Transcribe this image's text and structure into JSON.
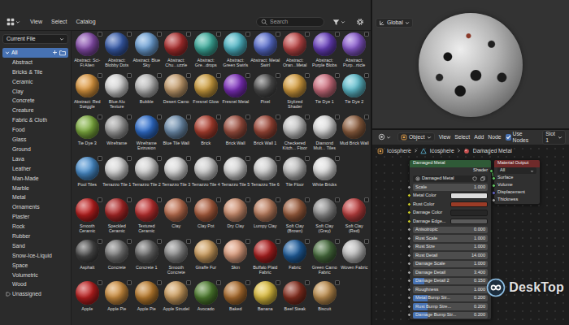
{
  "asset_browser": {
    "menus": [
      "View",
      "Select",
      "Catalog"
    ],
    "search": {
      "placeholder": "Search"
    },
    "library": "Current File",
    "catalog_root": {
      "label": "All",
      "selected": true,
      "expanded": true
    },
    "catalogs": [
      {
        "label": "Abstract",
        "selected": false
      },
      {
        "label": "Bricks & Tile",
        "selected": false
      },
      {
        "label": "Ceramic",
        "selected": false
      },
      {
        "label": "Clay",
        "selected": false
      },
      {
        "label": "Concrete",
        "selected": false
      },
      {
        "label": "Creature",
        "selected": false
      },
      {
        "label": "Fabric & Cloth",
        "selected": false
      },
      {
        "label": "Food",
        "selected": false
      },
      {
        "label": "Glass",
        "selected": false
      },
      {
        "label": "Ground",
        "selected": false
      },
      {
        "label": "Lava",
        "selected": false
      },
      {
        "label": "Leather",
        "selected": false
      },
      {
        "label": "Man-Made",
        "selected": false
      },
      {
        "label": "Marble",
        "selected": false
      },
      {
        "label": "Metal",
        "selected": false
      },
      {
        "label": "Ornaments",
        "selected": false
      },
      {
        "label": "Plaster",
        "selected": false
      },
      {
        "label": "Rock",
        "selected": false
      },
      {
        "label": "Rubber",
        "selected": false
      },
      {
        "label": "Sand",
        "selected": false
      },
      {
        "label": "Snow-Ice-Liquid",
        "selected": false
      },
      {
        "label": "Space",
        "selected": false
      },
      {
        "label": "Volumetric",
        "selected": false
      },
      {
        "label": "Wood",
        "selected": false
      }
    ],
    "unassigned": {
      "label": "Unassigned",
      "selected": false
    },
    "assets": [
      [
        {
          "label": "Abstract: Sci-Fi Alien",
          "color": "#8a4fb0"
        },
        {
          "label": "Abstract: Blobby Dots",
          "color": "#3a5fb0"
        },
        {
          "label": "Abstract: Blue Sky",
          "color": "#6fa3d9"
        },
        {
          "label": "Abstract: Chu...uzzle",
          "color": "#b03030"
        },
        {
          "label": "Abstract: Gre...drops",
          "color": "#3fb0a0"
        },
        {
          "label": "Abstract: Green Swirls",
          "color": "#4fb8c8"
        },
        {
          "label": "Abstract: Metal Swirl",
          "color": "#5a6fd0"
        },
        {
          "label": "Abstract: Oran...Metal",
          "color": "#c04848"
        },
        {
          "label": "Abstract: Purple Blobs",
          "color": "#6a40c0"
        },
        {
          "label": "Abstract: Purp...rticle",
          "color": "#8a5ad0"
        }
      ],
      [
        {
          "label": "Abstract: Red Swiggle",
          "color": "#e09a40"
        },
        {
          "label": "Blue Alu Texture",
          "color": "#d8d8d8"
        },
        {
          "label": "Bubble",
          "color": "#bcbcbc"
        },
        {
          "label": "Desert Camo",
          "color": "#c8a070"
        },
        {
          "label": "Fresnel Glow",
          "color": "#d0a040"
        },
        {
          "label": "Fresnel Metal",
          "color": "#8030c0"
        },
        {
          "label": "Pixel",
          "color": "#505050"
        },
        {
          "label": "Stylized Shader",
          "color": "#d8a040"
        },
        {
          "label": "Tie Dye 1",
          "color": "#d07080"
        },
        {
          "label": "Tie Dye 2",
          "color": "#60c0d0"
        }
      ],
      [
        {
          "label": "Tie Dye 3",
          "color": "#80b040"
        },
        {
          "label": "Wireframe",
          "color": "#a0a0a0"
        },
        {
          "label": "Wireframe Extrusion",
          "color": "#3070d0"
        },
        {
          "label": "Blue Tile Wall",
          "color": "#7090b0"
        },
        {
          "label": "Brick",
          "color": "#b04030"
        },
        {
          "label": "Brick Wall",
          "color": "#a05040"
        },
        {
          "label": "Brick Wall 1",
          "color": "#a04838"
        },
        {
          "label": "Checkered Kitch... Floor",
          "color": "#c8c8c8"
        },
        {
          "label": "Diamond Mult... Tiles",
          "color": "#e0e0e0"
        },
        {
          "label": "Mud Brick Wall",
          "color": "#906040"
        }
      ],
      [
        {
          "label": "Pool Tiles",
          "color": "#4a90d0"
        },
        {
          "label": "Terrazzo Tile 1",
          "color": "#d8d8d8"
        },
        {
          "label": "Terrazzo Tile 2",
          "color": "#d4d4d4"
        },
        {
          "label": "Terrazzo Tile 3",
          "color": "#dadada"
        },
        {
          "label": "Terrazzo Tile 4",
          "color": "#cfcfcf"
        },
        {
          "label": "Terrazzo Tile 5",
          "color": "#d6d6d6"
        },
        {
          "label": "Terrazzo Tile 6",
          "color": "#d2d2d2"
        },
        {
          "label": "Tile Floor",
          "color": "#c0c0c0"
        },
        {
          "label": "White Bricks",
          "color": "#e0e0e0"
        }
      ],
      [
        {
          "label": "Smooth Ceramic",
          "color": "#c02020"
        },
        {
          "label": "Speckled Ceramic",
          "color": "#b02828"
        },
        {
          "label": "Textured Ceramic",
          "color": "#c03030"
        },
        {
          "label": "Clay",
          "color": "#c07050"
        },
        {
          "label": "Clay Pot",
          "color": "#b06040"
        },
        {
          "label": "Dry Clay",
          "color": "#d09070"
        },
        {
          "label": "Lumpy Clay",
          "color": "#c08060"
        },
        {
          "label": "Soft Clay (Brown)",
          "color": "#a06040"
        },
        {
          "label": "Soft Clay (Grey)",
          "color": "#909090"
        },
        {
          "label": "Soft Clay (Red)",
          "color": "#c04040"
        }
      ],
      [
        {
          "label": "Asphalt",
          "color": "#4a4a4a"
        },
        {
          "label": "Concrete",
          "color": "#7a7a7a"
        },
        {
          "label": "Concrete 1",
          "color": "#6a6a6a"
        },
        {
          "label": "Smooth Concrete",
          "color": "#8a8a8a"
        },
        {
          "label": "Giraffe Fur",
          "color": "#d0a060"
        },
        {
          "label": "Skin",
          "color": "#e0a080"
        },
        {
          "label": "Buffalo Plaid Fabric",
          "color": "#b02020"
        },
        {
          "label": "Fabric",
          "color": "#2060a0"
        },
        {
          "label": "Green Camo Fabric",
          "color": "#4a7040"
        },
        {
          "label": "Woven Fabric",
          "color": "#c0c0c0"
        }
      ],
      [
        {
          "label": "Apple",
          "color": "#c02020"
        },
        {
          "label": "Apple Pie",
          "color": "#d09040"
        },
        {
          "label": "Apple Pie",
          "color": "#c08030"
        },
        {
          "label": "Apple Strudel",
          "color": "#d0a060"
        },
        {
          "label": "Avocado",
          "color": "#508030"
        },
        {
          "label": "Baked",
          "color": "#b07030"
        },
        {
          "label": "Banana",
          "color": "#e0c040"
        },
        {
          "label": "Beef Steak",
          "color": "#8a3020"
        },
        {
          "label": "Biscuit",
          "color": "#c09050"
        }
      ]
    ]
  },
  "viewport": {
    "orientation": "Global"
  },
  "node_editor": {
    "object_mode": "Object",
    "menus": [
      "View",
      "Select",
      "Add",
      "Node"
    ],
    "use_nodes": {
      "label": "Use Nodes",
      "checked": true
    },
    "slot": "Slot 1",
    "breadcrumb": [
      {
        "label": "Icosphere",
        "kind": "object"
      },
      {
        "label": "Icosphere",
        "kind": "mesh"
      },
      {
        "label": "Damaged Metal",
        "kind": "material"
      }
    ],
    "group_node": {
      "title": "Damaged Metal",
      "output": {
        "label": "Shader",
        "color": "#63c763"
      },
      "datablock": "Damaged Metal",
      "inputs": [
        {
          "label": "Scale",
          "kind": "value",
          "value": "1.000"
        },
        {
          "label": "Metal Color",
          "kind": "color",
          "color": "#dcdcdc"
        },
        {
          "label": "Rust Color",
          "kind": "color",
          "color": "#9a3b26"
        },
        {
          "label": "Damage Color",
          "kind": "color",
          "color": "#262626"
        },
        {
          "label": "Damage Edge...",
          "kind": "color",
          "color": "#5a5a5a"
        },
        {
          "label": "Anisotropic",
          "kind": "value",
          "value": "0.000"
        },
        {
          "label": "Rust Scale",
          "kind": "value",
          "value": "1.000"
        },
        {
          "label": "Rust Size",
          "kind": "value",
          "value": "1.000"
        },
        {
          "label": "Rust Detail",
          "kind": "value",
          "value": "14.000"
        },
        {
          "label": "Damage Scale",
          "kind": "value",
          "value": "1.000"
        },
        {
          "label": "Damage Detail",
          "kind": "value",
          "value": "3.400"
        },
        {
          "label": "Damage Detail 2",
          "kind": "factor",
          "value": "0.150",
          "level": 0.15
        },
        {
          "label": "Roughness",
          "kind": "value",
          "value": "1.000"
        },
        {
          "label": "Metal Bump Str...",
          "kind": "factor",
          "value": "0.200",
          "level": 0.2
        },
        {
          "label": "Rust Bump Stre...",
          "kind": "factor",
          "value": "0.200",
          "level": 0.2
        },
        {
          "label": "Damage Bump Str...",
          "kind": "factor",
          "value": "0.200",
          "level": 0.2
        }
      ]
    },
    "output_node": {
      "title": "Material Output",
      "target": "All",
      "inputs": [
        {
          "label": "Surface",
          "color": "#63c763"
        },
        {
          "label": "Volume",
          "color": "#63c763"
        },
        {
          "label": "Displacement",
          "color": "#6363c7"
        },
        {
          "label": "Thickness",
          "color": "#a1a1a1"
        }
      ]
    }
  },
  "watermark": "DeskTop"
}
